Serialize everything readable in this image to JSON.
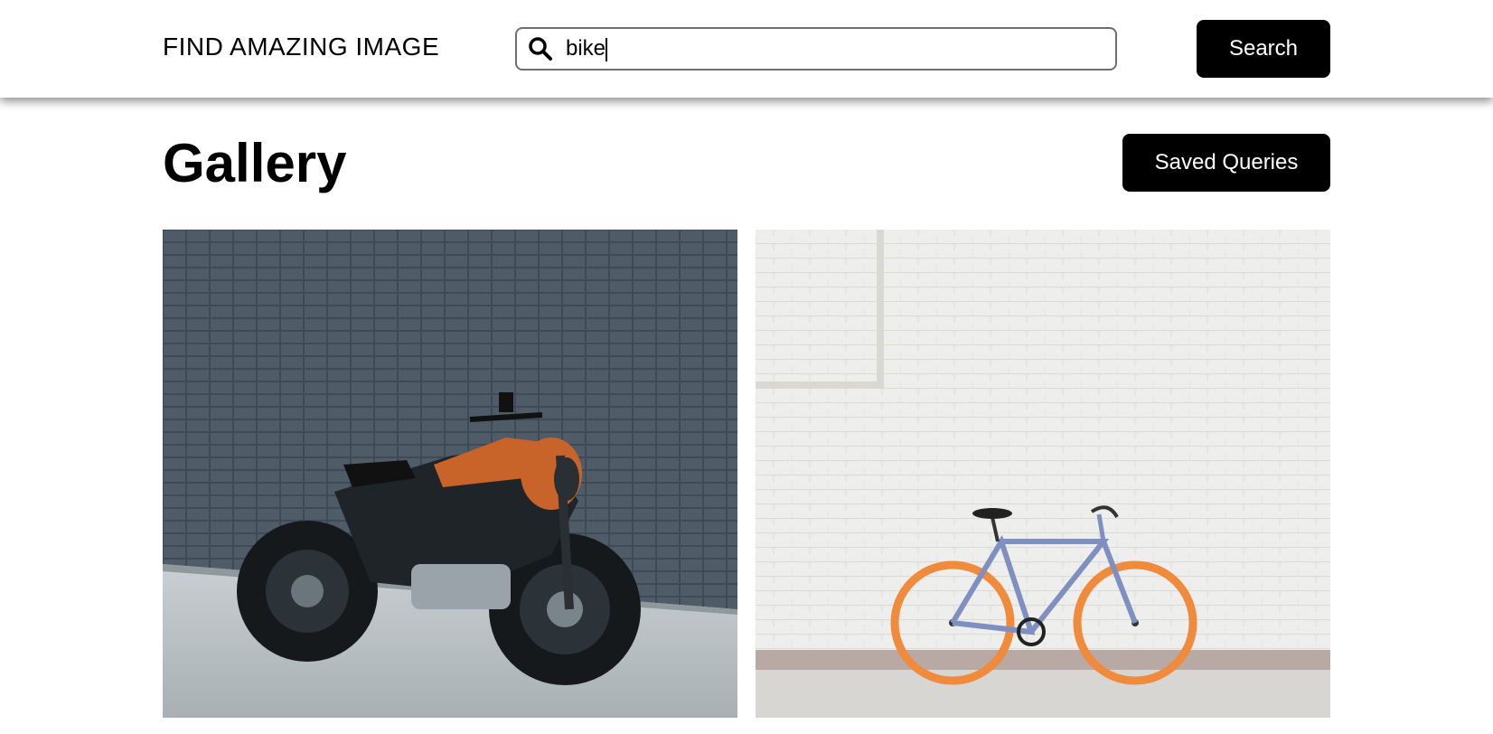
{
  "header": {
    "brand": "FIND AMAZING IMAGE",
    "search": {
      "value": "bike",
      "placeholder": ""
    },
    "search_button": "Search"
  },
  "main": {
    "title": "Gallery",
    "saved_queries_button": "Saved Queries"
  },
  "gallery": {
    "images": [
      {
        "icon": "motorcycle-photo",
        "alt": ""
      },
      {
        "icon": "bicycle-photo",
        "alt": ""
      }
    ]
  },
  "colors": {
    "accent": "#000000",
    "background": "#ffffff",
    "bike_wheel": "#f08a3c",
    "bike_frame": "#7f8fc0",
    "moto_tank": "#c8642a"
  }
}
